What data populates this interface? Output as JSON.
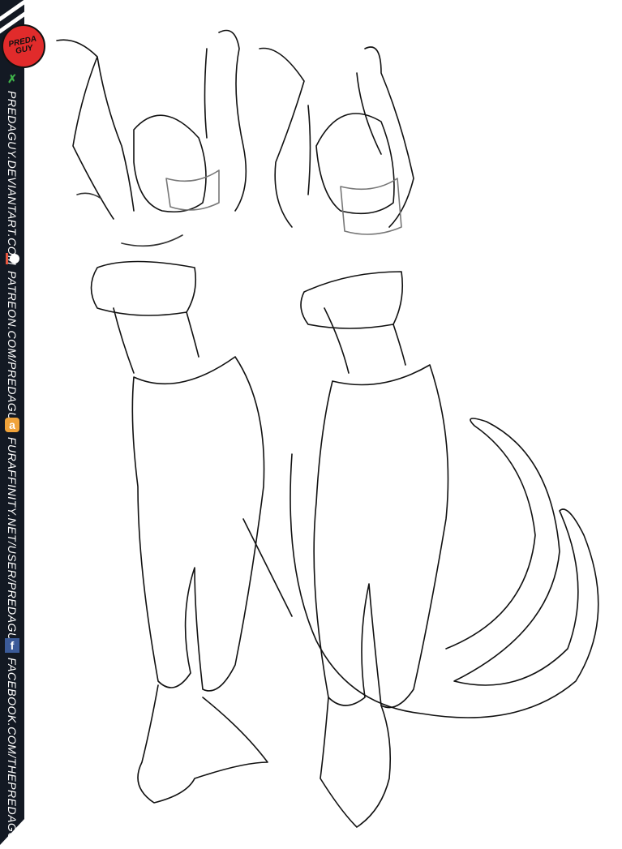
{
  "logo": {
    "text": "PREDA GUY"
  },
  "links": [
    {
      "icon": "deviantart-icon",
      "text": "PREDAGUY.DEVIANTART.COM",
      "color": "#3fb34a"
    },
    {
      "icon": "patreon-icon",
      "text": "PATREON.COM/PREDAGUY",
      "color": "#e8573f"
    },
    {
      "icon": "furaffinity-icon",
      "text": "FURAFFINITY.NET/USER/PREDAGUY",
      "color": "#f0a33a"
    },
    {
      "icon": "facebook-icon",
      "text": "FACEBOOK.COM/THEPREDAGUY",
      "color": "#3b5b99"
    }
  ]
}
